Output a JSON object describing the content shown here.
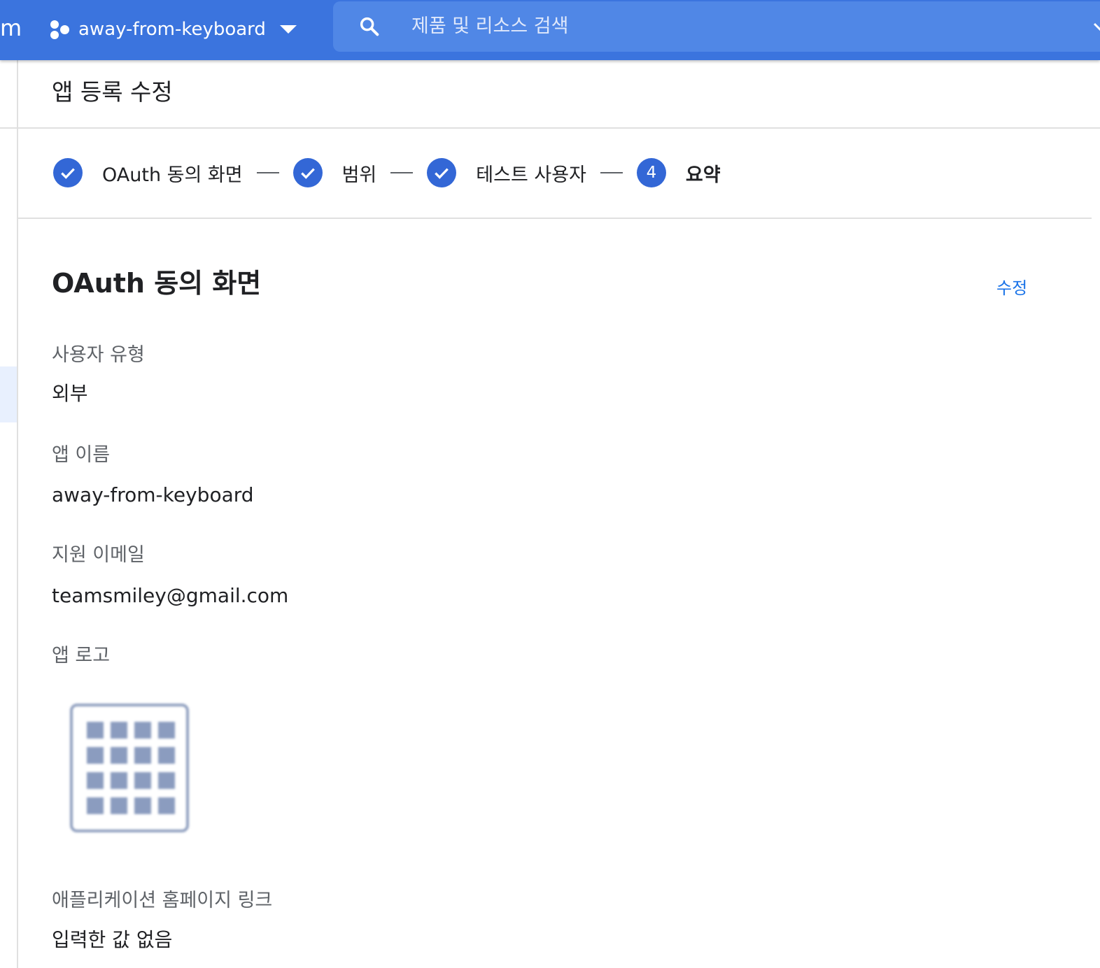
{
  "topbar": {
    "brand_fragment": "m",
    "project_name": "away-from-keyboard",
    "search_placeholder": "제품 및 리소스 검색"
  },
  "page": {
    "title": "앱 등록 수정"
  },
  "stepper": {
    "steps": [
      {
        "label": "OAuth 동의 화면",
        "state": "complete"
      },
      {
        "label": "범위",
        "state": "complete"
      },
      {
        "label": "테스트 사용자",
        "state": "complete"
      },
      {
        "label": "요약",
        "state": "current",
        "number": "4"
      }
    ]
  },
  "section": {
    "title": "OAuth 동의 화면",
    "edit_label": "수정",
    "fields": [
      {
        "label": "사용자 유형",
        "value": "외부"
      },
      {
        "label": "앱 이름",
        "value": "away-from-keyboard"
      },
      {
        "label": "지원 이메일",
        "value": "teamsmiley@gmail.com"
      },
      {
        "label": "앱 로고",
        "value": ""
      },
      {
        "label": "애플리케이션 홈페이지 링크",
        "value": "입력한 값 없음"
      }
    ]
  },
  "colors": {
    "topbar": "#3b74de",
    "search": "#5087e6",
    "accent": "#3367d6",
    "link": "#1a73e8"
  }
}
